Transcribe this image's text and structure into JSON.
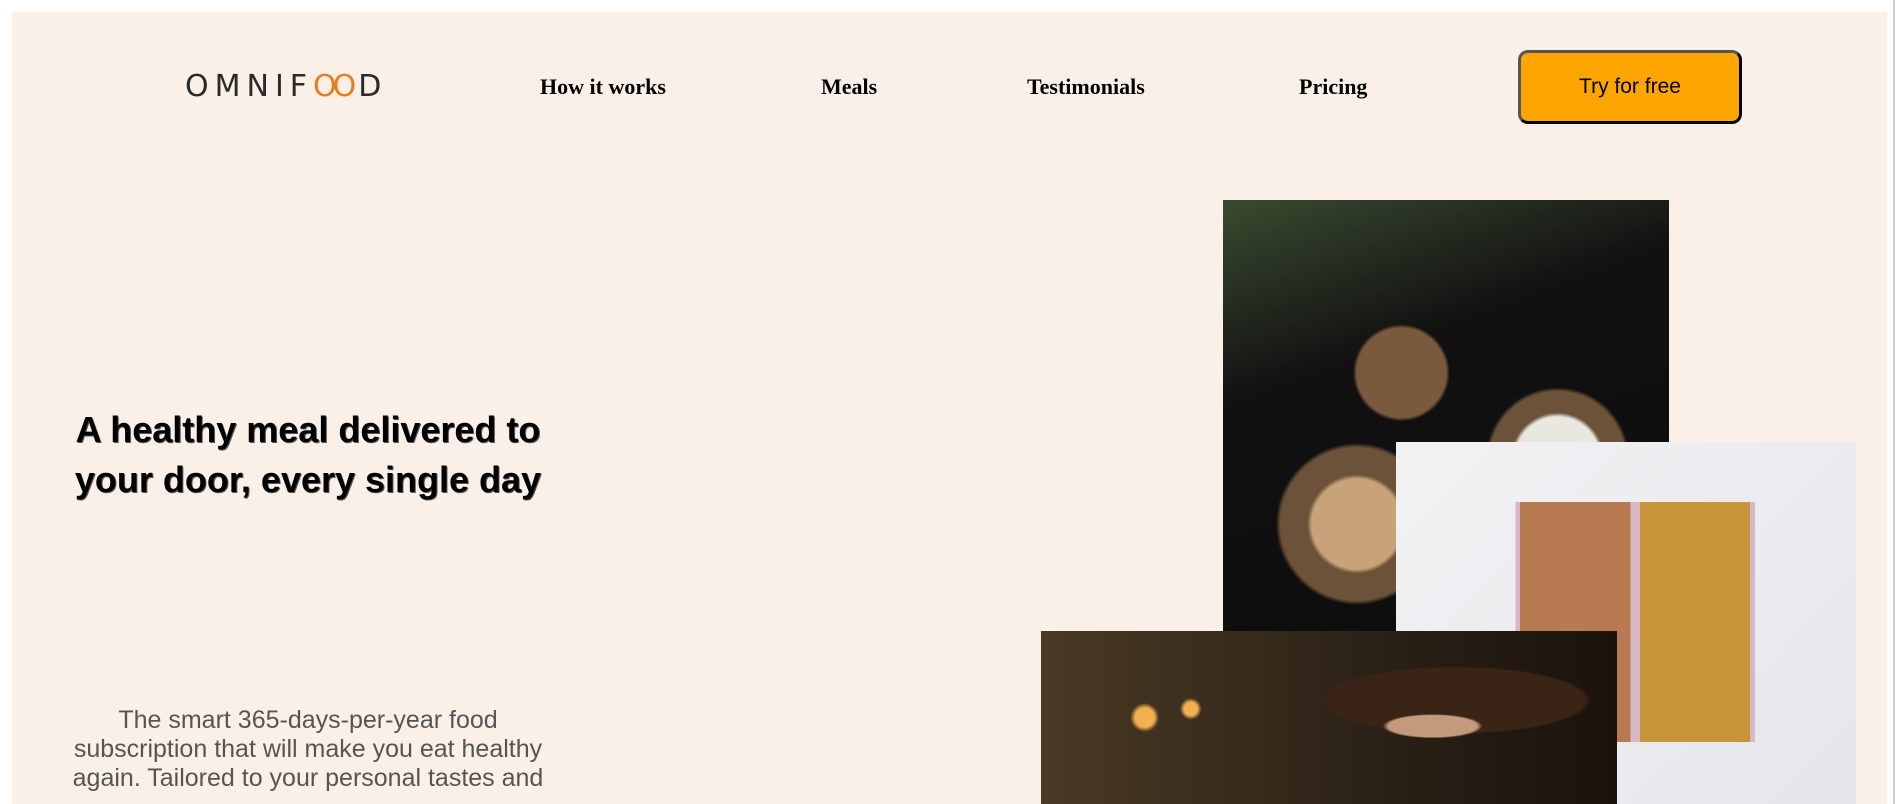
{
  "header": {
    "logo_text": "OMNIFOOD",
    "nav": [
      {
        "label": "How it works"
      },
      {
        "label": "Meals"
      },
      {
        "label": "Testimonials"
      },
      {
        "label": "Pricing"
      }
    ],
    "cta_label": "Try for free"
  },
  "hero": {
    "title": "A healthy meal delivered to your door, every single day",
    "description": "The smart 365-days-per-year food subscription that will make you eat healthy again. Tailored to your personal tastes and"
  },
  "colors": {
    "background": "#fbf0e8",
    "accent": "#ffa500",
    "logo_accent": "#e67e22"
  }
}
